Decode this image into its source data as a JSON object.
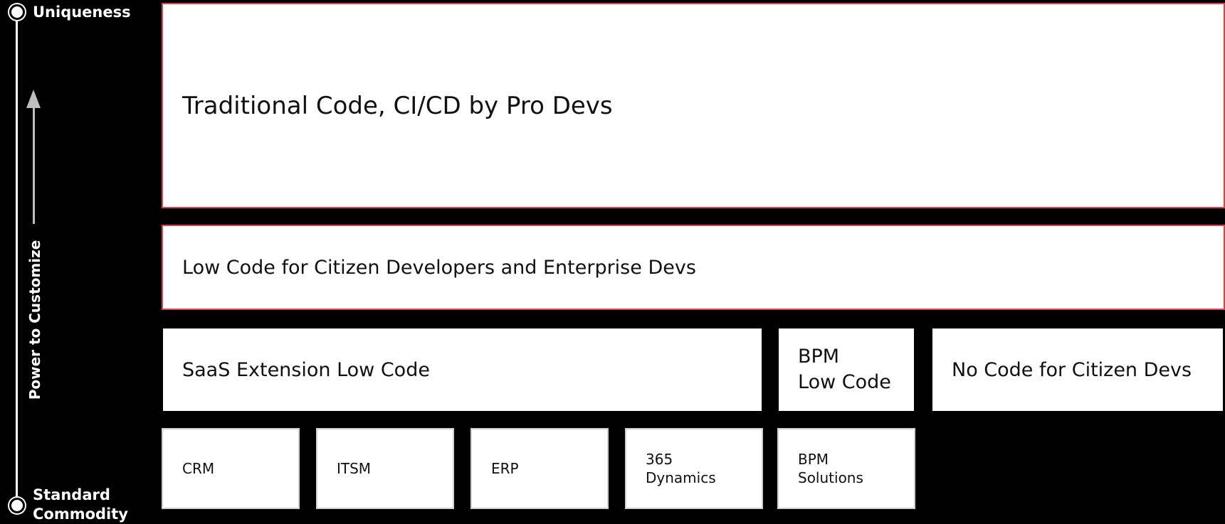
{
  "axis": {
    "top_label": "Uniqueness",
    "bottom_label": "Standard Commodity",
    "direction_label": "Power to Customize"
  },
  "layers": {
    "traditional": "Traditional Code, CI/CD by Pro Devs",
    "low_code": "Low Code for Citizen Developers and Enterprise Devs",
    "saas_extension": "SaaS Extension Low Code",
    "bpm_low_code": "BPM\nLow Code",
    "no_code": "No Code for Citizen Devs"
  },
  "foundation": [
    {
      "label": "CRM"
    },
    {
      "label": "ITSM"
    },
    {
      "label": "ERP"
    },
    {
      "label": "365\nDynamics"
    },
    {
      "label": "BPM\nSolutions"
    }
  ],
  "colors": {
    "background": "#000000",
    "box_fill": "#ffffff",
    "accent_border": "#d9434b",
    "arrow": "#bdbdbd"
  }
}
